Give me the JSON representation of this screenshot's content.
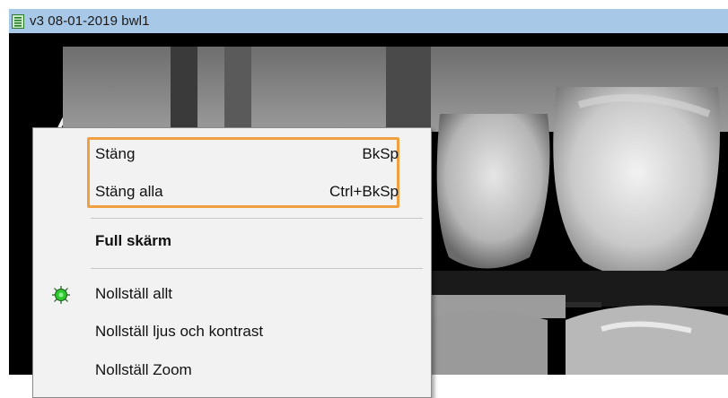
{
  "window": {
    "title": "v3  08-01-2019  bwl1",
    "icon": "document-list-icon"
  },
  "colors": {
    "titlebar_bg": "#a8c8e8",
    "menu_bg": "#f2f2f2",
    "highlight_border": "#f0a040",
    "status_icon": "#2ec82e"
  },
  "menu": {
    "items": [
      {
        "label": "Stäng",
        "shortcut": "BkSp"
      },
      {
        "label": "Stäng alla",
        "shortcut": "Ctrl+BkSp"
      },
      {
        "label": "Full skärm",
        "shortcut": ""
      },
      {
        "label": "Nollställ allt",
        "shortcut": "",
        "icon": "green-gear-icon"
      },
      {
        "label": "Nollställ ljus och kontrast",
        "shortcut": ""
      },
      {
        "label": "Nollställ Zoom",
        "shortcut": ""
      }
    ]
  }
}
